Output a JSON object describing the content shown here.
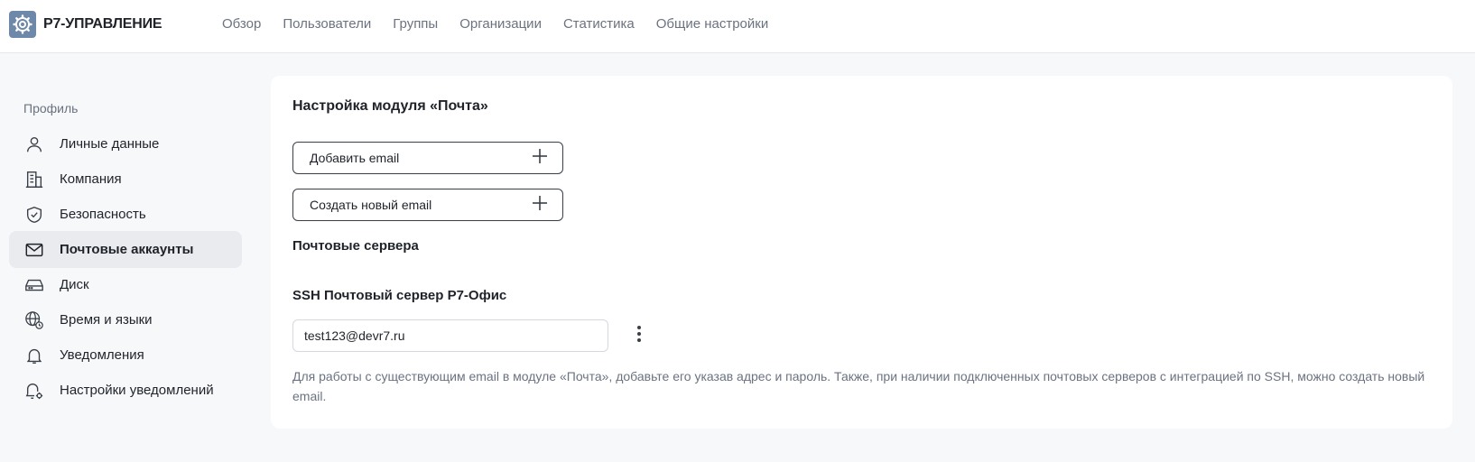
{
  "app": {
    "logo_text": "Р7-УПРАВЛЕНИЕ",
    "logo_icon": "gear-icon"
  },
  "topnav": {
    "items": [
      {
        "label": "Обзор"
      },
      {
        "label": "Пользователи"
      },
      {
        "label": "Группы"
      },
      {
        "label": "Организации"
      },
      {
        "label": "Статистика"
      },
      {
        "label": "Общие настройки"
      }
    ]
  },
  "sidebar": {
    "title": "Профиль",
    "items": [
      {
        "label": "Личные данные",
        "icon": "user-icon",
        "active": false
      },
      {
        "label": "Компания",
        "icon": "building-icon",
        "active": false
      },
      {
        "label": "Безопасность",
        "icon": "shield-check-icon",
        "active": false
      },
      {
        "label": "Почтовые аккаунты",
        "icon": "mail-icon",
        "active": true
      },
      {
        "label": "Диск",
        "icon": "disk-icon",
        "active": false
      },
      {
        "label": "Время и языки",
        "icon": "globe-clock-icon",
        "active": false
      },
      {
        "label": "Уведомления",
        "icon": "bell-icon",
        "active": false
      },
      {
        "label": "Настройки уведомлений",
        "icon": "bell-settings-icon",
        "active": false
      }
    ]
  },
  "main": {
    "title": "Настройка модуля «Почта»",
    "add_email_label": "Добавить email",
    "create_email_label": "Создать новый email",
    "servers_title": "Почтовые сервера",
    "server_name": "SSH Почтовый сервер Р7-Офис",
    "email_value": "test123@devr7.ru",
    "hint": "Для работы с существующим email в модуле «Почта», добавьте его указав адрес и пароль. Также, при наличии подключенных почтовых серверов с интеграцией по SSH, можно создать новый email."
  },
  "colors": {
    "accent_logo": "#6d88a8",
    "active_bg": "#e9ebef",
    "muted_text": "#6b7280",
    "page_bg": "#f7f8fa"
  }
}
